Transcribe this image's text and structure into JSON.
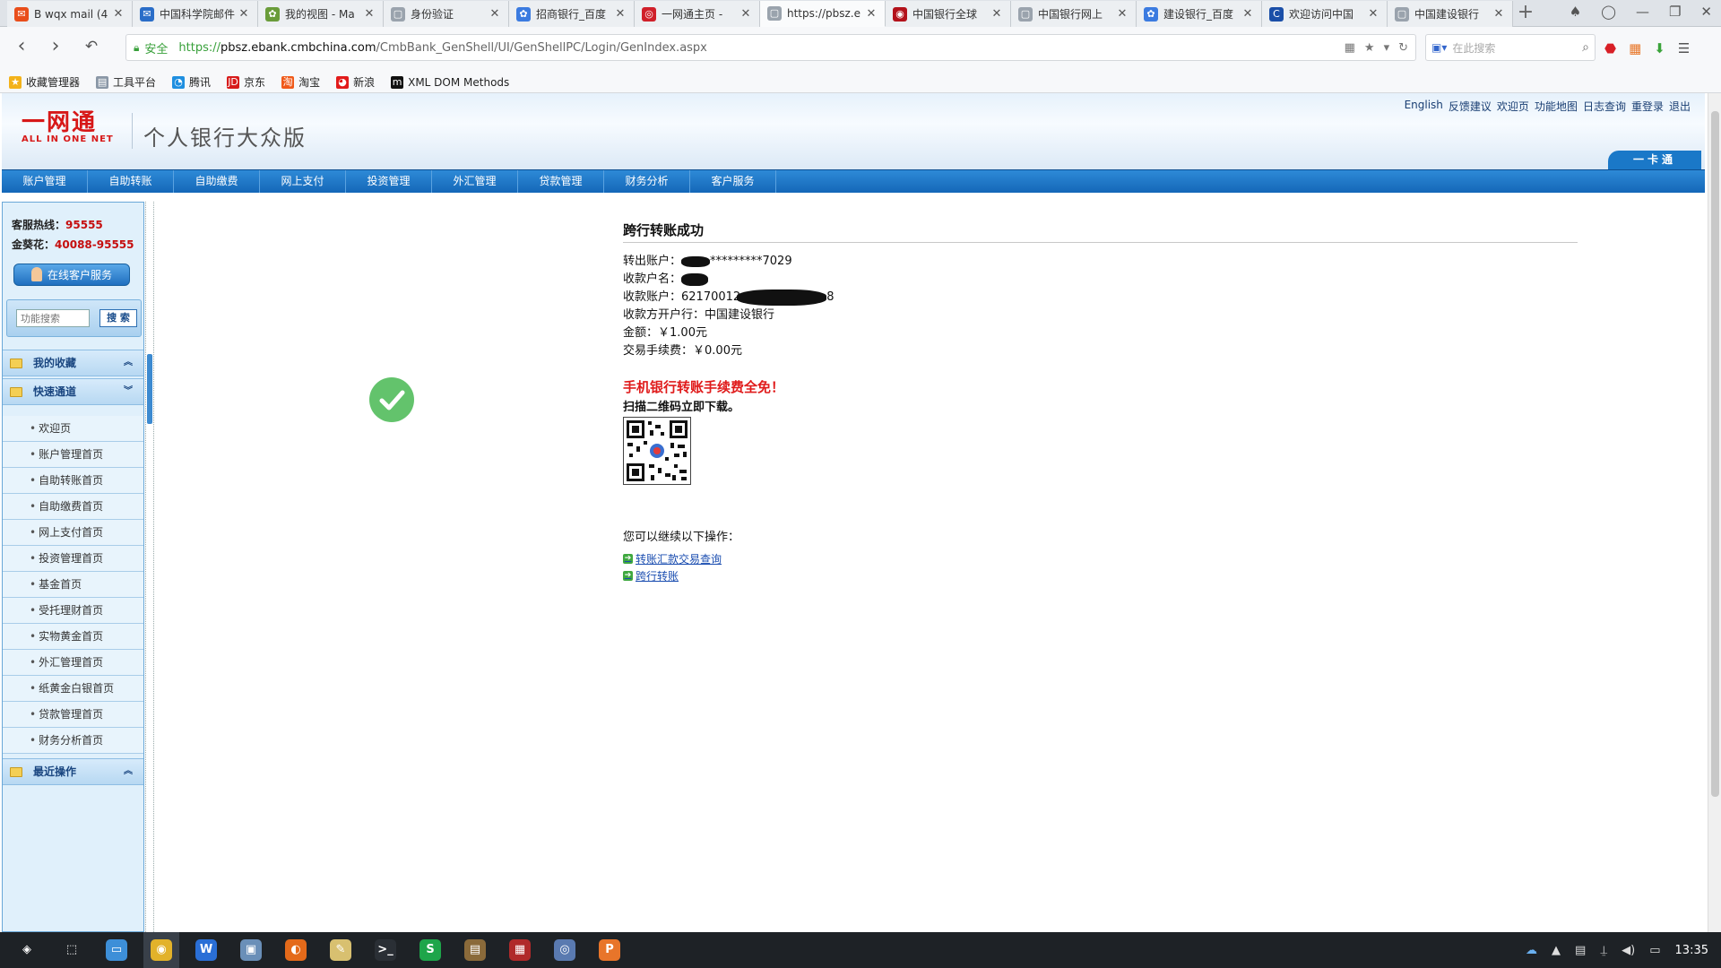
{
  "browser": {
    "tabs": [
      {
        "title": "B wqx mail (4",
        "color": "#e94e1b",
        "glyph": "✉"
      },
      {
        "title": "中国科学院邮件",
        "color": "#2a6dc8",
        "glyph": "✉"
      },
      {
        "title": "我的视图 - Ma",
        "color": "#6a9c3a",
        "glyph": "✿"
      },
      {
        "title": "身份验证",
        "color": "#9aa3ad",
        "glyph": "▢"
      },
      {
        "title": "招商银行_百度",
        "color": "#3b7be0",
        "glyph": "✿"
      },
      {
        "title": "一网通主页 -",
        "color": "#d0202a",
        "glyph": "◎"
      },
      {
        "title": "https://pbsz.e",
        "color": "#9aa3ad",
        "glyph": "▢"
      },
      {
        "title": "中国银行全球",
        "color": "#b3121b",
        "glyph": "◉"
      },
      {
        "title": "中国银行网上",
        "color": "#9aa3ad",
        "glyph": "▢"
      },
      {
        "title": "建设银行_百度",
        "color": "#3b7be0",
        "glyph": "✿"
      },
      {
        "title": "欢迎访问中国",
        "color": "#1b4fa8",
        "glyph": "C"
      },
      {
        "title": "中国建设银行",
        "color": "#9aa3ad",
        "glyph": "▢"
      }
    ],
    "active_tab_index": 6,
    "new_tab": "+",
    "address": {
      "secure_label": "安全",
      "scheme": "https://",
      "host": "pbsz.ebank.cmbchina.com",
      "path": "/CmbBank_GenShell/UI/GenShellPC/Login/GenIndex.aspx"
    },
    "search_placeholder": "在此搜索",
    "bookmarks": [
      {
        "label": "收藏管理器",
        "color": "#f3b21a",
        "glyph": "★"
      },
      {
        "label": "工具平台",
        "color": "#8a97a6",
        "glyph": "▤"
      },
      {
        "label": "腾讯",
        "color": "#1f8fe0",
        "glyph": "◔"
      },
      {
        "label": "京东",
        "color": "#d71b1b",
        "glyph": "JD"
      },
      {
        "label": "淘宝",
        "color": "#f05a1a",
        "glyph": "淘"
      },
      {
        "label": "新浪",
        "color": "#e21b1b",
        "glyph": "◕"
      },
      {
        "label": "XML DOM Methods",
        "color": "#111111",
        "glyph": "m"
      }
    ]
  },
  "bank": {
    "logo_top": "一网通",
    "logo_bottom": "ALL IN ONE NET",
    "site_title": "个人银行大众版",
    "top_links": [
      "English",
      "反馈建议",
      "欢迎页",
      "功能地图",
      "日志查询",
      "重登录",
      "退出"
    ],
    "card_tab": "一卡通",
    "nav": [
      "账户管理",
      "自助转账",
      "自助缴费",
      "网上支付",
      "投资管理",
      "外汇管理",
      "贷款管理",
      "财务分析",
      "客户服务"
    ],
    "sidebar": {
      "hotline_label": "客服热线：",
      "hotline": "95555",
      "vip_label": "金葵花：",
      "vip_hotline": "40088-95555",
      "online_service": "在线客户服务",
      "search_placeholder": "功能搜索",
      "search_button": "搜 索",
      "favorites": "我的收藏",
      "quick": "快速通道",
      "recent": "最近操作",
      "quick_items": [
        "欢迎页",
        "账户管理首页",
        "自助转账首页",
        "自助缴费首页",
        "网上支付首页",
        "投资管理首页",
        "基金首页",
        "受托理财首页",
        "实物黄金首页",
        "外汇管理首页",
        "纸黄金白银首页",
        "贷款管理首页",
        "财务分析首页"
      ]
    },
    "result": {
      "title": "跨行转账成功",
      "from_label": "转出账户：",
      "from_value": "*********7029",
      "payee_label": "收款户名：",
      "payee_account_label": "收款账户：",
      "payee_account_value": "62170012",
      "payee_account_tail": "8",
      "payee_bank_label": "收款方开户行：",
      "payee_bank_value": "中国建设银行",
      "amount_label": "金额：",
      "amount_value": "￥1.00元",
      "fee_label": "交易手续费：",
      "fee_value": "￥0.00元",
      "promo": "手机银行转账手续费全免！",
      "scan": "扫描二维码立即下载。",
      "next_ops": "您可以继续以下操作：",
      "links": [
        "转账汇款交易查询",
        "跨行转账"
      ]
    }
  },
  "taskbar": {
    "apps": [
      {
        "name": "deepin-launcher",
        "color": "#1e2226",
        "glyph": "◈"
      },
      {
        "name": "screenshot",
        "color": "#1e2226",
        "glyph": "⬚"
      },
      {
        "name": "file-manager",
        "color": "#3d8fd8",
        "glyph": "▭"
      },
      {
        "name": "chrome",
        "color": "#e2b22a",
        "glyph": "◉"
      },
      {
        "name": "wps-writer",
        "color": "#2a6fd6",
        "glyph": "W"
      },
      {
        "name": "virtualbox",
        "color": "#6a8fb8",
        "glyph": "▣"
      },
      {
        "name": "firefox",
        "color": "#e46a1a",
        "glyph": "◐"
      },
      {
        "name": "text-editor",
        "color": "#d8c070",
        "glyph": "✎"
      },
      {
        "name": "terminal",
        "color": "#2a2f35",
        "glyph": ">_"
      },
      {
        "name": "wps-spreadsheet",
        "color": "#1ea54a",
        "glyph": "S"
      },
      {
        "name": "archive",
        "color": "#8a6a3a",
        "glyph": "▤"
      },
      {
        "name": "system-monitor",
        "color": "#b02a2a",
        "glyph": "▦"
      },
      {
        "name": "screen-recorder",
        "color": "#5a7ab0",
        "glyph": "◎"
      },
      {
        "name": "wps-presentation",
        "color": "#e8752a",
        "glyph": "P"
      }
    ],
    "time": "13:35"
  }
}
